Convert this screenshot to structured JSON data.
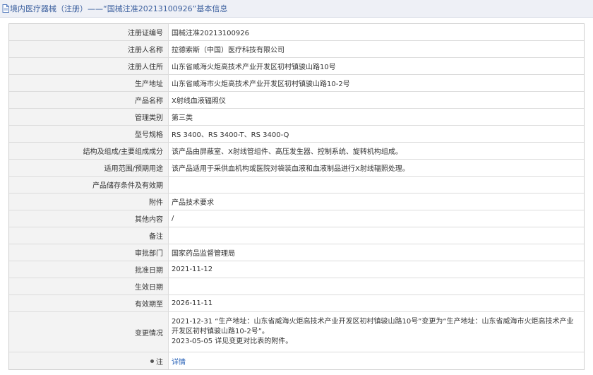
{
  "header": {
    "title": "境内医疗器械（注册）——“国械注准20213100926”基本信息",
    "color": "#3b5f9e"
  },
  "rows": [
    {
      "label": "注册证编号",
      "value": "国械注准20213100926"
    },
    {
      "label": "注册人名称",
      "value": "拉德索斯（中国）医疗科技有限公司"
    },
    {
      "label": "注册人住所",
      "value": "山东省威海火炬高技术产业开发区初村镇骏山路10号"
    },
    {
      "label": "生产地址",
      "value": "山东省威海市火炬高技术产业开发区初村镇骏山路10-2号"
    },
    {
      "label": "产品名称",
      "value": "X射线血液辐照仪"
    },
    {
      "label": "管理类别",
      "value": "第三类"
    },
    {
      "label": "型号规格",
      "value": "RS 3400、RS 3400-T、RS 3400-Q"
    },
    {
      "label": "结构及组成/主要组成成分",
      "value": "该产品由屏蔽室、X射线管组件、高压发生器、控制系统、旋转机构组成。"
    },
    {
      "label": "适用范围/预期用途",
      "value": "该产品适用于采供血机构或医院对袋装血液和血液制品进行X射线辐照处理。"
    },
    {
      "label": "产品储存条件及有效期",
      "value": ""
    },
    {
      "label": "附件",
      "value": "产品技术要求"
    },
    {
      "label": "其他内容",
      "value": "/"
    },
    {
      "label": "备注",
      "value": ""
    },
    {
      "label": "审批部门",
      "value": "国家药品监督管理局"
    },
    {
      "label": "批准日期",
      "value": "2021-11-12"
    },
    {
      "label": "生效日期",
      "value": ""
    },
    {
      "label": "有效期至",
      "value": "2026-11-11"
    }
  ],
  "change": {
    "label": "变更情况",
    "line1": "2021-12-31 “生产地址：山东省威海火炬高技术产业开发区初村镇骏山路10号”变更为“生产地址：山东省威海市火炬高技术产业",
    "line2": "开发区初村镇骏山路10-2号”。",
    "line3": "2023-05-05 详见变更对比表的附件。"
  },
  "detail": {
    "label": "注",
    "link": "详情",
    "link_color": "#2a63b8"
  }
}
